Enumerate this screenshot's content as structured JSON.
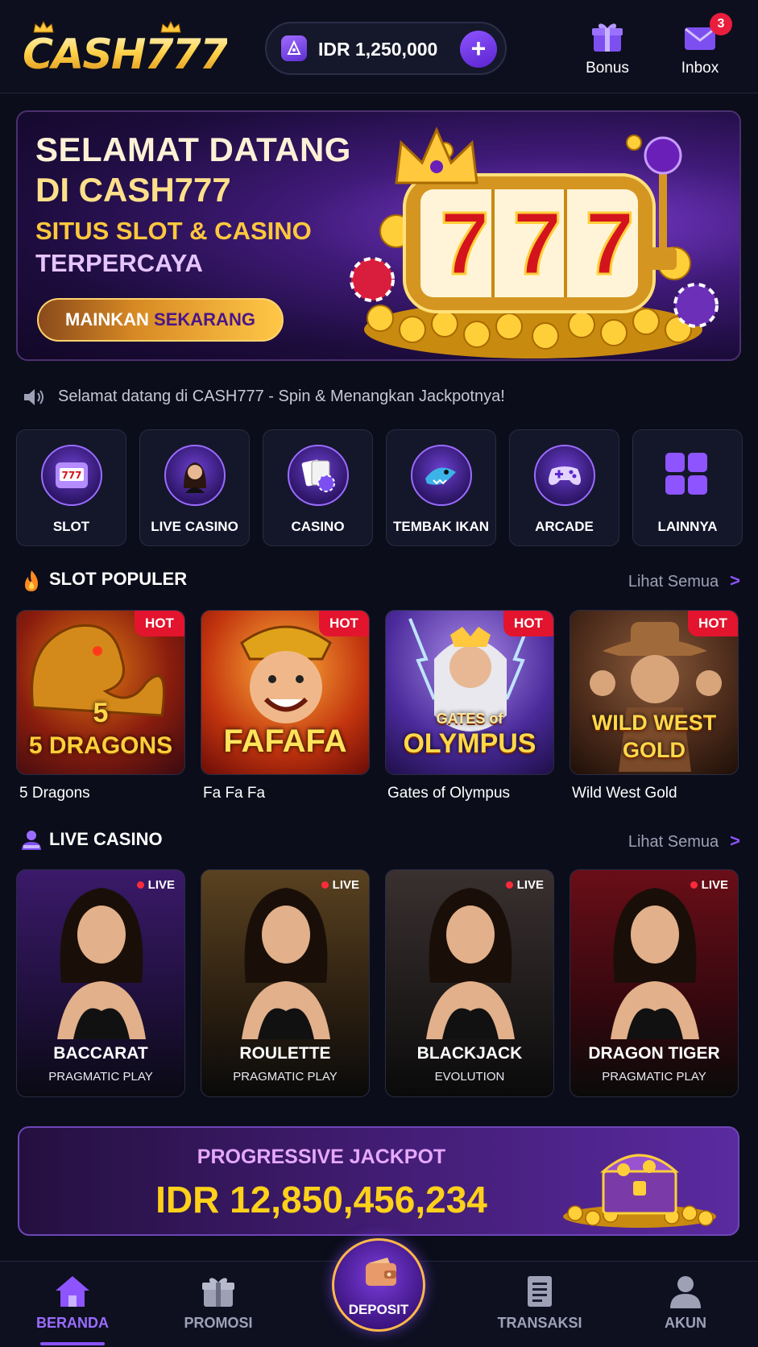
{
  "header": {
    "logo_text": "CASH777",
    "balance": "IDR 1,250,000",
    "bonus_label": "Bonus",
    "inbox_label": "Inbox",
    "inbox_badge": "3"
  },
  "hero": {
    "line1": "SELAMAT DATANG",
    "line2": "DI CASH777",
    "line3": "SITUS SLOT & CASINO",
    "line4": "TERPERCAYA",
    "cta_white": "MAINKAN ",
    "cta_purple": "SEKARANG",
    "reel_digits": [
      "7",
      "7",
      "7"
    ]
  },
  "marquee": "Selamat datang di CASH777 - Spin & Menangkan Jackpotnya!",
  "categories": [
    {
      "label": "SLOT",
      "icon": "slot-machine-icon"
    },
    {
      "label": "LIVE CASINO",
      "icon": "dealer-icon"
    },
    {
      "label": "CASINO",
      "icon": "cards-chip-icon"
    },
    {
      "label": "TEMBAK IKAN",
      "icon": "shark-icon"
    },
    {
      "label": "ARCADE",
      "icon": "gamepad-icon"
    },
    {
      "label": "LAINNYA",
      "icon": "grid-icon"
    }
  ],
  "slot_section": {
    "title": "SLOT POPULER",
    "see_all": "Lihat Semua",
    "games": [
      {
        "name": "5 Dragons",
        "art_title": "5 DRAGONS",
        "art_number": "5",
        "badge": "HOT"
      },
      {
        "name": "Fa Fa Fa",
        "art_title": "FAFAFA",
        "badge": "HOT"
      },
      {
        "name": "Gates of Olympus",
        "art_small": "GATES of",
        "art_title": "OLYMPUS",
        "badge": "HOT"
      },
      {
        "name": "Wild West Gold",
        "art_title": "WILD WEST",
        "art_sub": "GOLD",
        "badge": "HOT"
      }
    ]
  },
  "live_section": {
    "title": "LIVE CASINO",
    "see_all": "Lihat Semua",
    "tables": [
      {
        "name": "BACCARAT",
        "provider": "PRAGMATIC PLAY",
        "tag": "LIVE"
      },
      {
        "name": "ROULETTE",
        "provider": "PRAGMATIC PLAY",
        "tag": "LIVE"
      },
      {
        "name": "BLACKJACK",
        "provider": "EVOLUTION",
        "tag": "LIVE"
      },
      {
        "name": "DRAGON TIGER",
        "provider": "PRAGMATIC PLAY",
        "tag": "LIVE"
      }
    ]
  },
  "jackpot": {
    "title": "PROGRESSIVE JACKPOT",
    "value": "IDR 12,850,456,234"
  },
  "bottom_nav": {
    "home": "BERANDA",
    "promo": "PROMOSI",
    "deposit": "DEPOSIT",
    "transactions": "TRANSAKSI",
    "account": "AKUN"
  },
  "colors": {
    "accent_purple": "#8d54ff",
    "gold": "#ffd11a",
    "hot_red": "#e3142e",
    "background": "#0b0d1a"
  }
}
